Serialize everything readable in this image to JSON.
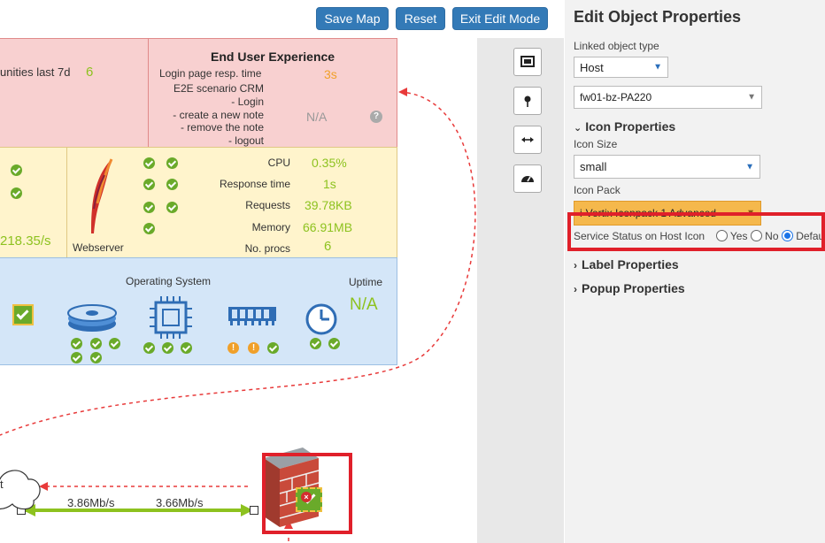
{
  "toolbar": {
    "save_label": "Save Map",
    "reset_label": "Reset",
    "exit_label": "Exit Edit Mode"
  },
  "map": {
    "red_left": {
      "label": "unities last 7d",
      "value": "6"
    },
    "eue": {
      "title": "End User Experience",
      "login_label": "Login page resp. time",
      "login_value": "3s",
      "scenario_lines": [
        "E2E scenario CRM",
        "- Login",
        "- create a new note",
        "- remove the note",
        "- logout"
      ],
      "scenario_value": "N/A"
    },
    "yellow_left": {
      "value": "218.35/s"
    },
    "webserver": {
      "label": "Webserver",
      "metrics": [
        {
          "label": "CPU",
          "value": "0.35%"
        },
        {
          "label": "Response time",
          "value": "1s"
        },
        {
          "label": "Requests",
          "value": "39.78KB"
        },
        {
          "label": "Memory",
          "value": "66.91MB"
        },
        {
          "label": "No. procs",
          "value": "6"
        }
      ]
    },
    "os": {
      "title": "Operating System",
      "uptime_label": "Uptime",
      "uptime_value": "N/A"
    },
    "link": {
      "left_rate": "3.86Mb/s",
      "right_rate": "3.66Mb/s"
    },
    "cloud_letter": "t"
  },
  "sidebar": {
    "title": "Edit Object Properties",
    "linked_type_label": "Linked object type",
    "linked_type_value": "Host",
    "host_value": "fw01-bz-PA220",
    "icon_props_label": "Icon Properties",
    "icon_size_label": "Icon Size",
    "icon_size_value": "small",
    "icon_pack_label": "Icon Pack",
    "icon_pack_value": "i-Vertix Iconpack 1 Advanced",
    "service_status_label": "Service Status on Host Icon",
    "radio_yes": "Yes",
    "radio_no": "No",
    "radio_default": "Default",
    "label_props_label": "Label Properties",
    "popup_props_label": "Popup Properties"
  },
  "colors": {
    "accent": "#337ab7",
    "ok": "#8dc21f",
    "warn": "#f0a02a",
    "highlight": "#e0202a"
  }
}
